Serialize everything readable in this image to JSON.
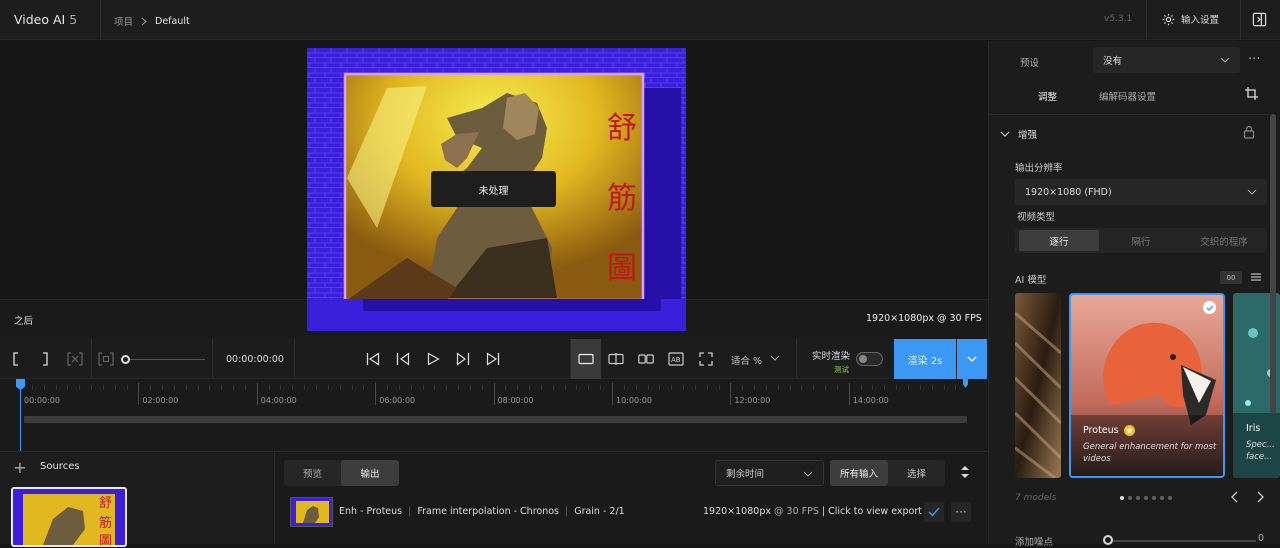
{
  "app": {
    "name": "Video AI",
    "version_major": "5",
    "version": "v5.3.1"
  },
  "breadcrumb": {
    "root": "项目",
    "current": "Default"
  },
  "header": {
    "settings_label": "输入设置"
  },
  "viewer": {
    "overlay_label": "未处理",
    "after_label": "之后",
    "resolution_info": "1920×1080px @ 30 FPS",
    "video_caption": [
      "舒",
      "筋",
      "圖"
    ]
  },
  "transport": {
    "timecode": "00:00:00:00",
    "fit_label": "适合 %",
    "realtime_label": "实时渲染",
    "realtime_sub": "测试",
    "realtime_on": false,
    "render_label": "渲染 2s"
  },
  "timeline": {
    "ticks": [
      "00:00:00",
      "02:00:00",
      "04:00:00",
      "06:00:00",
      "08:00:00",
      "10:00:00",
      "12:00:00",
      "14:00:00"
    ]
  },
  "sources": {
    "label": "Sources",
    "add": "+"
  },
  "export_panel": {
    "tabs": [
      "预览",
      "输出"
    ],
    "active_tab": "输出",
    "remaining_label": "剩余时间",
    "filter": [
      "所有输入",
      "选择"
    ],
    "row": {
      "enh": "Enh - Proteus",
      "interp": "Frame interpolation - Chronos",
      "grain": "Grain - 2/1",
      "resolution": "1920×1080px",
      "fps": "@ 30 FPS",
      "link": "| Click to view export",
      "more": "···"
    }
  },
  "right_panel": {
    "preset_label": "预设",
    "preset_value": "没有",
    "more": "···",
    "tabs": [
      "调整",
      "编解码器设置"
    ],
    "section": "增强",
    "output_res_label": "输出分辨率",
    "output_res_value": "1920×1080 (FHD)",
    "video_type_label": "视频类型",
    "video_types": [
      "逐行",
      "隔行",
      "交织的程序"
    ],
    "ai_model_label": "AI 模型",
    "ai_toggle": "00",
    "models": [
      {
        "name": "Proteus",
        "desc": "General enhancement for most videos",
        "selected": true
      },
      {
        "name": "Iris",
        "desc": "Spec... face..."
      }
    ],
    "model_count": "7 models",
    "carousel_dots": 7,
    "carousel_active": 0,
    "noise_label": "添加噪点",
    "noise_value": "0"
  },
  "colors": {
    "accent": "#3b98f5",
    "video_bg": "#3a1ad8",
    "gold": "#f0c020",
    "seal_red": "#c21616"
  }
}
